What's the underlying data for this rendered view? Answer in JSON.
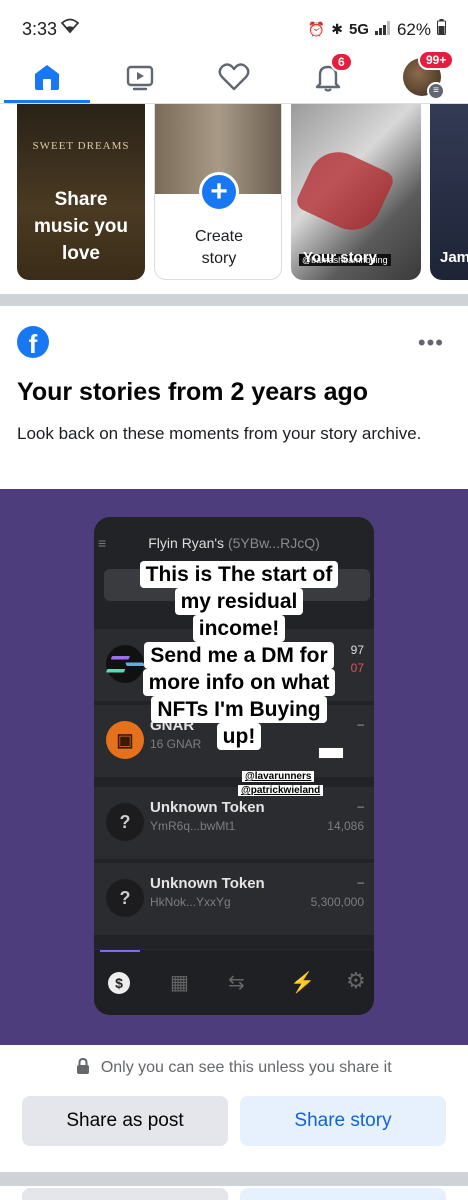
{
  "status": {
    "time": "3:33",
    "network": "5G",
    "battery": "62%"
  },
  "nav": {
    "notifications_badge": "6",
    "menu_badge": "99+"
  },
  "stories": [
    {
      "label": "Share music you love",
      "art_title": "SWEET DREAMS"
    },
    {
      "label": "Create story"
    },
    {
      "label": "Your story",
      "overlay_user": "@bamashbamnbping"
    },
    {
      "label": "Jam"
    }
  ],
  "memory": {
    "title": "Your stories from 2 years ago",
    "subtitle": "Look back on these moments from your story archive."
  },
  "story_post": {
    "wallet_header": "Flyin Ryan's",
    "wallet_address": "(5YBw...RJcQ)",
    "captions": [
      "This is The start of",
      "my residual",
      "income!",
      "Send me a DM for",
      "more info on what",
      "NFTs I'm Buying",
      "up!"
    ],
    "tags": [
      "@lavarunners",
      "@patrickwieland"
    ],
    "tokens": [
      {
        "name": "",
        "sub": "",
        "amount": "97",
        "amount2": "07"
      },
      {
        "name": "GNAR",
        "sub": "16 GNAR",
        "amount": ""
      },
      {
        "name": "Unknown Token",
        "sub": "YmR6q...bwMt1",
        "amount": "14,086",
        "dash": "–"
      },
      {
        "name": "Unknown Token",
        "sub": "HkNok...YxxYg",
        "amount": "5,300,000",
        "dash": "–"
      }
    ]
  },
  "privacy_note": "Only you can see this unless you share it",
  "buttons": {
    "share_post": "Share as post",
    "share_story": "Share story"
  },
  "colors": {
    "accent": "#1877f2",
    "badge": "#e41e3f",
    "purple_bg": "#4e3d7c"
  }
}
